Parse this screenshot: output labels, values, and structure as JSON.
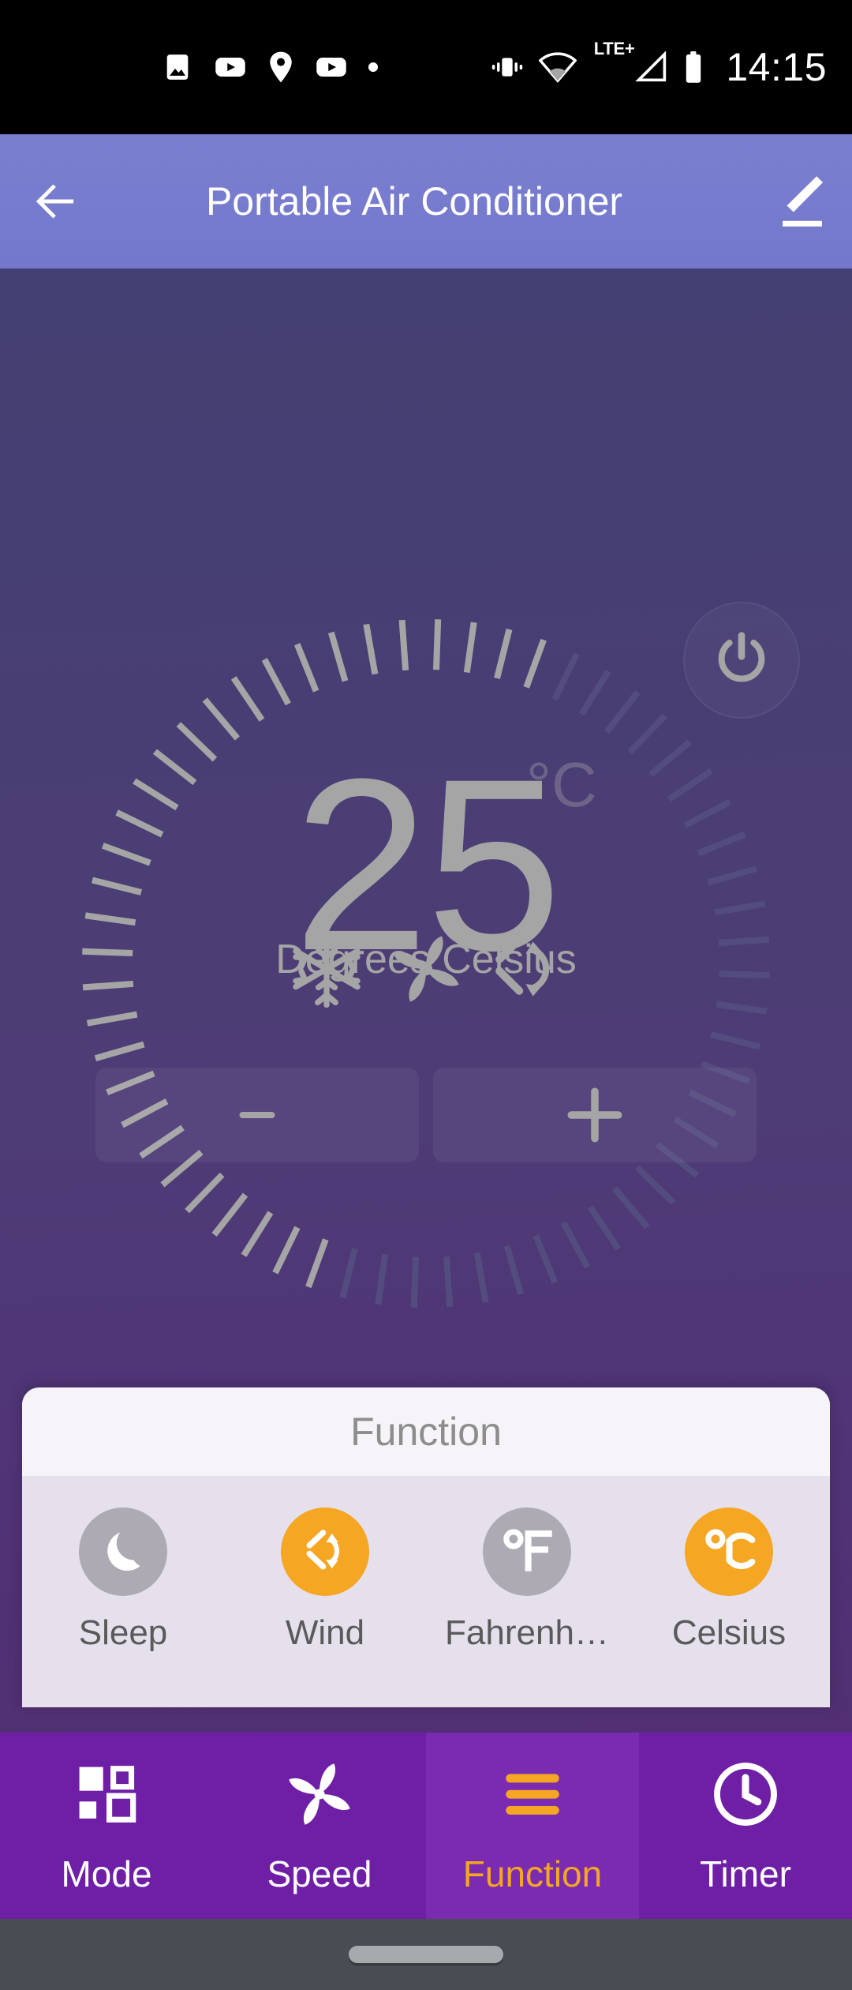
{
  "status_bar": {
    "time": "14:15",
    "network_label": "LTE+",
    "left_icons": [
      "image-icon",
      "youtube-icon",
      "location-pin-icon",
      "youtube-icon",
      "dot-icon"
    ],
    "right_icons": [
      "vibrate-icon",
      "wifi-icon",
      "signal-icon",
      "battery-icon"
    ]
  },
  "app_bar": {
    "title": "Portable Air Conditioner",
    "back_icon": "arrow-left-icon",
    "edit_icon": "pencil-icon",
    "accent": "#7378cb"
  },
  "device": {
    "power_icon": "power-icon",
    "temperature": "25",
    "unit_symbol": "°C",
    "unit_label": "Degrees Celsius",
    "decrease_label": "−",
    "increase_label": "+",
    "overlay_icons": [
      "snowflake-icon",
      "fan-icon",
      "swing-arrows-icon"
    ],
    "dial": {
      "total_ticks": 60,
      "active_ticks": 31,
      "active_color": "#a5a5a5",
      "inactive_color": "#534c7e"
    }
  },
  "function_panel": {
    "title": "Function",
    "items": [
      {
        "label": "Sleep",
        "icon": "moon-icon",
        "active": false
      },
      {
        "label": "Wind",
        "icon": "swing-arrows-icon",
        "active": true
      },
      {
        "label": "Fahrenh…",
        "icon": "fahrenheit-icon",
        "active": false
      },
      {
        "label": "Celsius",
        "icon": "celsius-icon",
        "active": true
      }
    ],
    "active_color": "#f5a623",
    "inactive_color": "#adaab3"
  },
  "bottom_nav": {
    "items": [
      {
        "label": "Mode",
        "icon": "squares-icon",
        "active": false
      },
      {
        "label": "Speed",
        "icon": "fan-icon",
        "active": false
      },
      {
        "label": "Function",
        "icon": "hamburger-icon",
        "active": true
      },
      {
        "label": "Timer",
        "icon": "clock-icon",
        "active": false
      }
    ],
    "accent": "#f5a623",
    "bar_color": "#6e1fa5"
  },
  "gesture_bar": {
    "handle": "home-handle"
  }
}
